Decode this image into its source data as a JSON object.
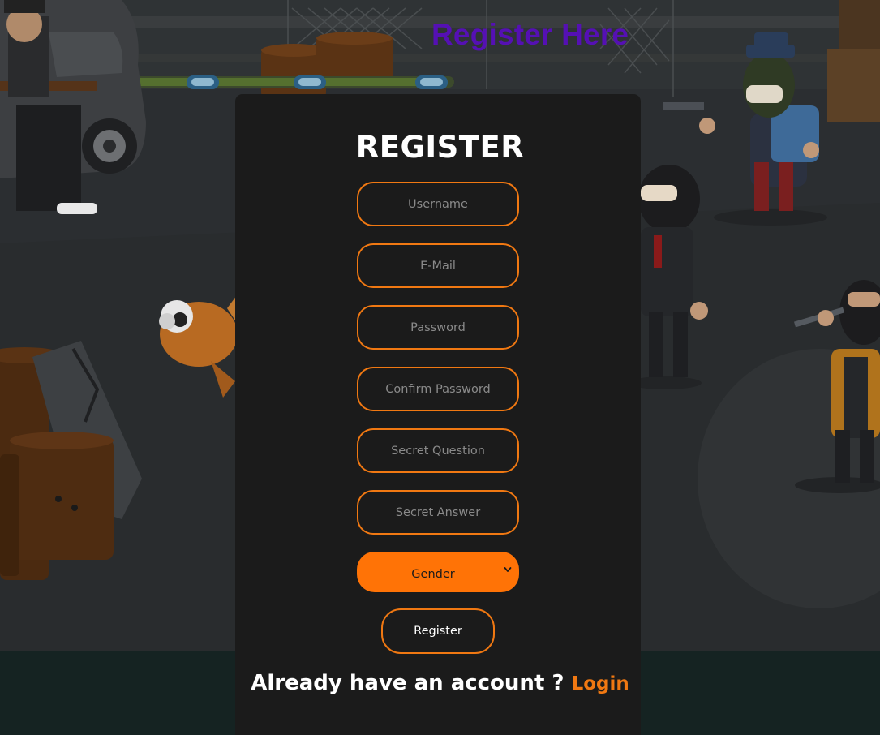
{
  "page": {
    "heading": "Register Here"
  },
  "form": {
    "title": "REGISTER",
    "fields": {
      "username": {
        "placeholder": "Username",
        "value": ""
      },
      "email": {
        "placeholder": "E-Mail",
        "value": ""
      },
      "password": {
        "placeholder": "Password",
        "value": ""
      },
      "confirm_password": {
        "placeholder": "Confirm Password",
        "value": ""
      },
      "secret_question": {
        "placeholder": "Secret Question",
        "value": ""
      },
      "secret_answer": {
        "placeholder": "Secret Answer",
        "value": ""
      }
    },
    "gender": {
      "selected": "Gender"
    },
    "submit_label": "Register",
    "footer": {
      "prompt": "Already have an account ? ",
      "login_label": "Login"
    }
  },
  "colors": {
    "accent": "#f07812",
    "heading": "#5510b4",
    "card_background": "#1b1b1b",
    "select_background": "#ff7306"
  }
}
